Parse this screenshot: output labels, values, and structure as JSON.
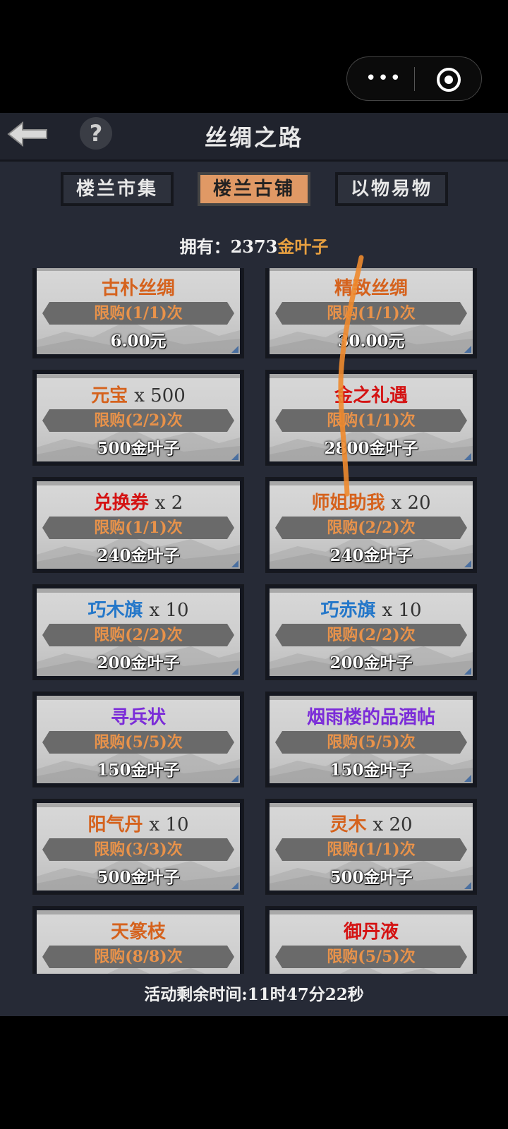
{
  "miniprogram": {
    "more_icon": "ellipsis-icon",
    "close_icon": "target-icon"
  },
  "header": {
    "title": "丝绸之路",
    "back_icon": "back-arrow-icon",
    "help_icon": "question-icon",
    "help_glyph": "?"
  },
  "tabs": [
    {
      "label": "楼兰市集",
      "active": false
    },
    {
      "label": "楼兰古铺",
      "active": true
    },
    {
      "label": "以物易物",
      "active": false
    }
  ],
  "owned": {
    "label": "拥有：",
    "amount": "2373",
    "currency": "金叶子"
  },
  "items": [
    {
      "name": "古朴丝绸",
      "qty": "",
      "name_color": "#d5621d",
      "limit": "限购(1/1)次",
      "price": "6.00元"
    },
    {
      "name": "精致丝绸",
      "qty": "",
      "name_color": "#d5621d",
      "limit": "限购(1/1)次",
      "price": "30.00元"
    },
    {
      "name": "元宝",
      "qty": "x 500",
      "name_color": "#d5621d",
      "limit": "限购(2/2)次",
      "price": "500金叶子"
    },
    {
      "name": "金之礼遇",
      "qty": "",
      "name_color": "#d41313",
      "limit": "限购(1/1)次",
      "price": "2800金叶子"
    },
    {
      "name": "兑换券",
      "qty": "x 2",
      "name_color": "#d41313",
      "limit": "限购(1/1)次",
      "price": "240金叶子"
    },
    {
      "name": "师姐助我",
      "qty": "x 20",
      "name_color": "#d5621d",
      "limit": "限购(2/2)次",
      "price": "240金叶子"
    },
    {
      "name": "巧木旗",
      "qty": "x 10",
      "name_color": "#2477c9",
      "limit": "限购(2/2)次",
      "price": "200金叶子"
    },
    {
      "name": "巧赤旗",
      "qty": "x 10",
      "name_color": "#2477c9",
      "limit": "限购(2/2)次",
      "price": "200金叶子"
    },
    {
      "name": "寻兵状",
      "qty": "",
      "name_color": "#7b2cd8",
      "limit": "限购(5/5)次",
      "price": "150金叶子"
    },
    {
      "name": "烟雨楼的品酒帖",
      "qty": "",
      "name_color": "#7b2cd8",
      "limit": "限购(5/5)次",
      "price": "150金叶子"
    },
    {
      "name": "阳气丹",
      "qty": "x 10",
      "name_color": "#d5621d",
      "limit": "限购(3/3)次",
      "price": "500金叶子"
    },
    {
      "name": "灵木",
      "qty": "x 20",
      "name_color": "#d5621d",
      "limit": "限购(1/1)次",
      "price": "500金叶子"
    },
    {
      "name": "天篆枝",
      "qty": "",
      "name_color": "#d5621d",
      "limit": "限购(8/8)次",
      "price": ""
    },
    {
      "name": "御丹液",
      "qty": "",
      "name_color": "#d41313",
      "limit": "限购(5/5)次",
      "price": ""
    }
  ],
  "footer": {
    "countdown": "活动剩余时间:11时47分22秒"
  }
}
